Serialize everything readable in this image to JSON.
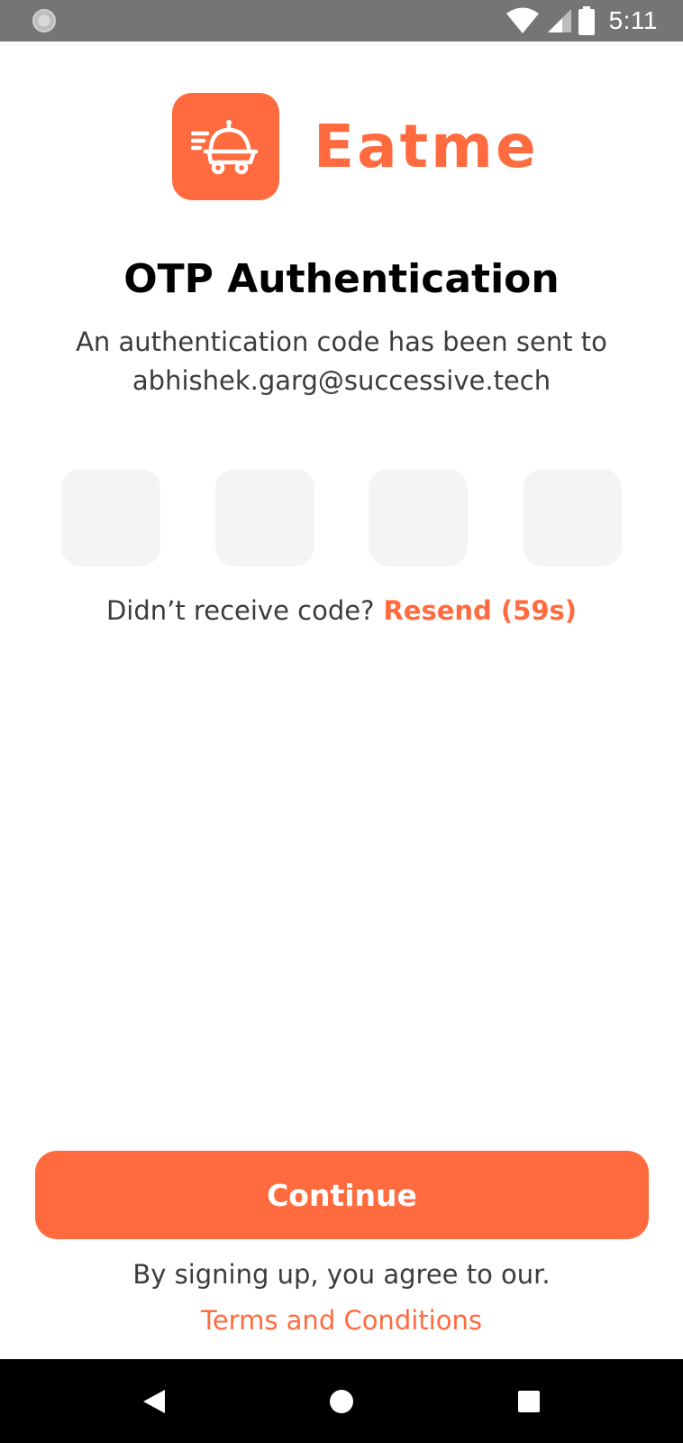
{
  "status_bar": {
    "time": "5:11",
    "icons": [
      "notification-icon",
      "wifi-icon",
      "signal-icon",
      "battery-icon"
    ]
  },
  "brand": {
    "name": "Eatme",
    "logo_icon": "food-delivery-cart-icon",
    "color": "#FF6B3F"
  },
  "page": {
    "title": "OTP Authentication",
    "subtitle_line1": "An authentication code has been sent to",
    "subtitle_line2": "abhishek.garg@successive.tech"
  },
  "otp": {
    "digits": [
      "",
      "",
      "",
      ""
    ]
  },
  "resend": {
    "prompt": "Didn’t receive code?",
    "link_label": "Resend (59s)"
  },
  "continue_label": "Continue",
  "terms": {
    "agree_text": "By signing up, you agree to our.",
    "link_label": "Terms and Conditions"
  },
  "nav": {
    "back": "back-triangle-icon",
    "home": "home-circle-icon",
    "recents": "recents-square-icon"
  }
}
